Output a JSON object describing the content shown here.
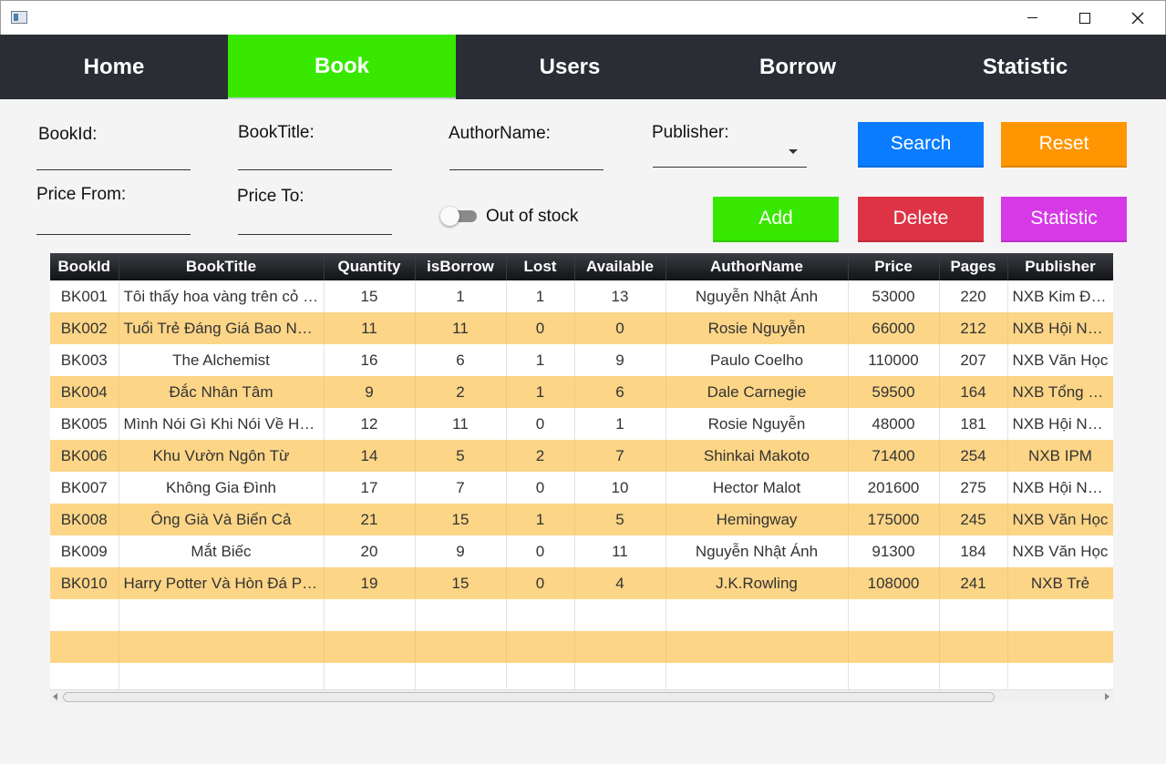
{
  "window": {
    "icon": "app-window-icon",
    "controls": {
      "minimize": "minimize-icon",
      "maximize": "maximize-icon",
      "close": "close-icon"
    }
  },
  "nav": {
    "tabs": [
      {
        "label": "Home",
        "active": false
      },
      {
        "label": "Book",
        "active": true
      },
      {
        "label": "Users",
        "active": false
      },
      {
        "label": "Borrow",
        "active": false
      },
      {
        "label": "Statistic",
        "active": false
      }
    ],
    "active_color": "#38e800"
  },
  "form": {
    "book_id_label": "BookId:",
    "book_title_label": "BookTitle:",
    "author_name_label": "AuthorName:",
    "publisher_label": "Publisher:",
    "price_from_label": "Price From:",
    "price_to_label": "Price To:",
    "out_of_stock_label": "Out of stock",
    "out_of_stock_checked": false,
    "book_id_value": "",
    "book_title_value": "",
    "author_name_value": "",
    "publisher_selected": "",
    "price_from_value": "",
    "price_to_value": ""
  },
  "buttons": {
    "search": "Search",
    "reset": "Reset",
    "add": "Add",
    "delete": "Delete",
    "statistic": "Statistic",
    "colors": {
      "search": "#0a7cff",
      "reset": "#ff9500",
      "add": "#38e800",
      "delete": "#dd3344",
      "statistic": "#d63ae6"
    }
  },
  "table": {
    "columns": [
      "BookId",
      "BookTitle",
      "Quantity",
      "isBorrow",
      "Lost",
      "Available",
      "AuthorName",
      "Price",
      "Pages",
      "Publisher"
    ],
    "rows": [
      [
        "BK001",
        "Tôi thấy hoa vàng trên cỏ xanh",
        "15",
        "1",
        "1",
        "13",
        "Nguyễn Nhật Ánh",
        "53000",
        "220",
        "NXB Kim Đồng"
      ],
      [
        "BK002",
        "Tuổi Trẻ Đáng Giá Bao Nhiêu",
        "11",
        "11",
        "0",
        "0",
        "Rosie Nguyễn",
        "66000",
        "212",
        "NXB Hội Nhà Văn"
      ],
      [
        "BK003",
        "The Alchemist",
        "16",
        "6",
        "1",
        "9",
        "Paulo Coelho",
        "110000",
        "207",
        "NXB Văn Học"
      ],
      [
        "BK004",
        "Đắc Nhân Tâm",
        "9",
        "2",
        "1",
        "6",
        "Dale Carnegie",
        "59500",
        "164",
        "NXB Tổng Hợp"
      ],
      [
        "BK005",
        "Mình Nói Gì Khi Nói Về Hạnh Phúc",
        "12",
        "11",
        "0",
        "1",
        "Rosie Nguyễn",
        "48000",
        "181",
        "NXB Hội Nhà Văn"
      ],
      [
        "BK006",
        "Khu Vườn Ngôn Từ",
        "14",
        "5",
        "2",
        "7",
        "Shinkai Makoto",
        "71400",
        "254",
        "NXB IPM"
      ],
      [
        "BK007",
        "Không Gia Đình",
        "17",
        "7",
        "0",
        "10",
        "Hector Malot",
        "201600",
        "275",
        "NXB Hội Nhà Văn"
      ],
      [
        "BK008",
        "Ông Già Và Biển Cả",
        "21",
        "15",
        "1",
        "5",
        "Hemingway",
        "175000",
        "245",
        "NXB Văn Học"
      ],
      [
        "BK009",
        "Mắt Biếc",
        "20",
        "9",
        "0",
        "11",
        "Nguyễn Nhật Ánh",
        "91300",
        "184",
        "NXB Văn Học"
      ],
      [
        "BK010",
        "Harry Potter Và Hòn Đá Phù Thủy",
        "19",
        "15",
        "0",
        "4",
        "J.K.Rowling",
        "108000",
        "241",
        "NXB Trẻ"
      ]
    ],
    "empty_rows": 3,
    "stripe_color": "#fcd587"
  }
}
